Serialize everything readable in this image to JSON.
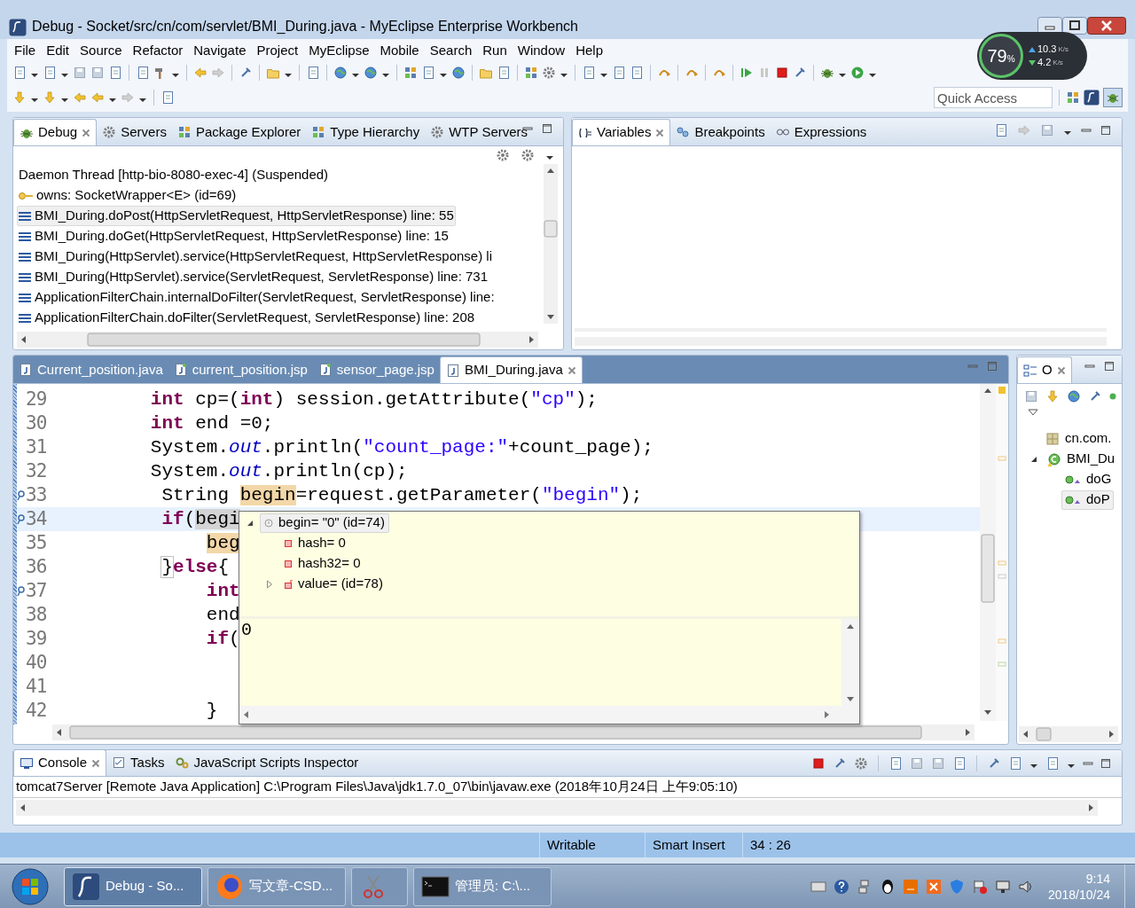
{
  "window": {
    "title": "Debug - Socket/src/cn/com/servlet/BMI_During.java - MyEclipse Enterprise Workbench"
  },
  "menu": [
    "File",
    "Edit",
    "Source",
    "Refactor",
    "Navigate",
    "Project",
    "MyEclipse",
    "Mobile",
    "Search",
    "Run",
    "Window",
    "Help"
  ],
  "quick_access": {
    "placeholder": "Quick Access"
  },
  "net_monitor": {
    "cpu": "79",
    "cpu_unit": "%",
    "up": "10.3",
    "up_unit": "K/s",
    "down": "4.2",
    "down_unit": "K/s"
  },
  "debug_panel": {
    "tabs": [
      {
        "label": "Debug",
        "selected": true
      },
      {
        "label": "Servers",
        "selected": false
      },
      {
        "label": "Package Explorer",
        "selected": false
      },
      {
        "label": "Type Hierarchy",
        "selected": false
      },
      {
        "label": "WTP Servers",
        "selected": false
      }
    ],
    "items": [
      {
        "kind": "thread",
        "text": "Daemon Thread [http-bio-8080-exec-4] (Suspended)",
        "selected": false
      },
      {
        "kind": "monitor",
        "text": "owns: SocketWrapper<E>  (id=69)",
        "selected": false
      },
      {
        "kind": "frame",
        "text": "BMI_During.doPost(HttpServletRequest, HttpServletResponse) line: 55",
        "selected": true
      },
      {
        "kind": "frame",
        "text": "BMI_During.doGet(HttpServletRequest, HttpServletResponse) line: 15",
        "selected": false
      },
      {
        "kind": "frame",
        "text": "BMI_During(HttpServlet).service(HttpServletRequest, HttpServletResponse) li",
        "selected": false
      },
      {
        "kind": "frame",
        "text": "BMI_During(HttpServlet).service(ServletRequest, ServletResponse) line: 731",
        "selected": false
      },
      {
        "kind": "frame",
        "text": "ApplicationFilterChain.internalDoFilter(ServletRequest, ServletResponse) line:",
        "selected": false
      },
      {
        "kind": "frame",
        "text": "ApplicationFilterChain.doFilter(ServletRequest, ServletResponse) line: 208",
        "selected": false
      }
    ]
  },
  "variables_panel": {
    "tabs": [
      {
        "label": "Variables",
        "selected": true
      },
      {
        "label": "Breakpoints",
        "selected": false
      },
      {
        "label": "Expressions",
        "selected": false
      }
    ]
  },
  "editor": {
    "tabs": [
      {
        "label": "Current_position.java",
        "kind": "java",
        "selected": false
      },
      {
        "label": "current_position.jsp",
        "kind": "jsp",
        "selected": false
      },
      {
        "label": "sensor_page.jsp",
        "kind": "jsp",
        "selected": false
      },
      {
        "label": "BMI_During.java",
        "kind": "java",
        "selected": true
      }
    ],
    "lines": [
      {
        "number": "29",
        "marker": false,
        "current": false,
        "tokens": [
          {
            "kind": "keyword",
            "text": "int"
          },
          {
            "kind": "plain",
            "text": " cp=("
          },
          {
            "kind": "keyword",
            "text": "int"
          },
          {
            "kind": "plain",
            "text": ") session.getAttribute("
          },
          {
            "kind": "string",
            "text": "\"cp\""
          },
          {
            "kind": "plain",
            "text": ");"
          }
        ]
      },
      {
        "number": "30",
        "marker": false,
        "current": false,
        "tokens": [
          {
            "kind": "keyword",
            "text": "int"
          },
          {
            "kind": "plain",
            "text": " end =0;"
          }
        ]
      },
      {
        "number": "31",
        "marker": false,
        "current": false,
        "tokens": [
          {
            "kind": "plain",
            "text": "System."
          },
          {
            "kind": "static_field",
            "text": "out"
          },
          {
            "kind": "plain",
            "text": ".println("
          },
          {
            "kind": "string",
            "text": "\"count_page:\""
          },
          {
            "kind": "plain",
            "text": "+count_page);"
          }
        ]
      },
      {
        "number": "32",
        "marker": false,
        "current": false,
        "tokens": [
          {
            "kind": "plain",
            "text": "System."
          },
          {
            "kind": "static_field",
            "text": "out"
          },
          {
            "kind": "plain",
            "text": ".println(cp);"
          }
        ]
      },
      {
        "number": "33",
        "marker": true,
        "current": false,
        "tokens": [
          {
            "kind": "plain",
            "text": "String "
          },
          {
            "kind": "occurrence",
            "text": "begin"
          },
          {
            "kind": "plain",
            "text": "=request.getParameter("
          },
          {
            "kind": "string",
            "text": "\"begin\""
          },
          {
            "kind": "plain",
            "text": ");"
          }
        ]
      },
      {
        "number": "34",
        "marker": true,
        "current": true,
        "tokens": [
          {
            "kind": "keyword",
            "text": "if"
          },
          {
            "kind": "plain",
            "text": "("
          },
          {
            "kind": "selected_occurrence",
            "text": "begi"
          }
        ]
      },
      {
        "number": "35",
        "marker": false,
        "current": false,
        "tokens": [
          {
            "kind": "occurrence",
            "text": "beg"
          }
        ]
      },
      {
        "number": "36",
        "marker": false,
        "current": false,
        "tokens": [
          {
            "kind": "bracket_match",
            "text": "}"
          },
          {
            "kind": "keyword",
            "text": "else"
          },
          {
            "kind": "plain",
            "text": "{"
          }
        ]
      },
      {
        "number": "37",
        "marker": true,
        "current": false,
        "tokens": [
          {
            "kind": "keyword",
            "text": "int"
          }
        ]
      },
      {
        "number": "38",
        "marker": false,
        "current": false,
        "tokens": [
          {
            "kind": "plain",
            "text": "end"
          }
        ]
      },
      {
        "number": "39",
        "marker": false,
        "current": false,
        "tokens": [
          {
            "kind": "keyword",
            "text": "if"
          },
          {
            "kind": "plain",
            "text": "("
          }
        ]
      },
      {
        "number": "40",
        "marker": false,
        "current": false
      },
      {
        "number": "41",
        "marker": false,
        "current": false
      },
      {
        "number": "42",
        "marker": false,
        "current": false,
        "tokens": [
          {
            "kind": "plain",
            "text": "}"
          }
        ]
      }
    ]
  },
  "hover": {
    "tree": [
      {
        "kind": "object",
        "text": "begin= \"0\" (id=74)",
        "expanded": true,
        "selected": true,
        "children": [
          {
            "kind": "field",
            "text": "hash= 0",
            "selected": false
          },
          {
            "kind": "field",
            "text": "hash32= 0",
            "selected": false
          },
          {
            "kind": "array",
            "text": "value= (id=78)",
            "expanded": false,
            "selected": false
          }
        ]
      }
    ],
    "detail": "0"
  },
  "outline": {
    "tabs": [
      {
        "label": "O",
        "selected": true
      }
    ],
    "tree": [
      {
        "kind": "package",
        "text": "cn.com.",
        "selected": false
      },
      {
        "kind": "class",
        "text": "BMI_Du",
        "expanded": true,
        "selected": false,
        "children": [
          {
            "kind": "method",
            "text": "doG",
            "selected": false
          },
          {
            "kind": "method",
            "text": "doP",
            "selected": true
          }
        ]
      }
    ]
  },
  "console": {
    "tabs": [
      {
        "label": "Console",
        "selected": true
      },
      {
        "label": "Tasks",
        "selected": false
      },
      {
        "label": "JavaScript Scripts Inspector",
        "selected": false
      }
    ],
    "header": "tomcat7Server [Remote Java Application] C:\\Program Files\\Java\\jdk1.7.0_07\\bin\\javaw.exe (2018年10月24日 上午9:05:10)"
  },
  "status_bar": [
    "Writable",
    "Smart Insert",
    "34 : 26"
  ],
  "taskbar": {
    "buttons": [
      {
        "kind": "myeclipse",
        "label": "Debug - So...",
        "selected": true
      },
      {
        "kind": "firefox",
        "label": "写文章-CSD...",
        "selected": false
      },
      {
        "kind": "snipping",
        "selected": false
      },
      {
        "kind": "terminal",
        "label": "管理员: C:\\...",
        "selected": false
      }
    ],
    "time": "9:14",
    "date": "2018/10/24"
  }
}
